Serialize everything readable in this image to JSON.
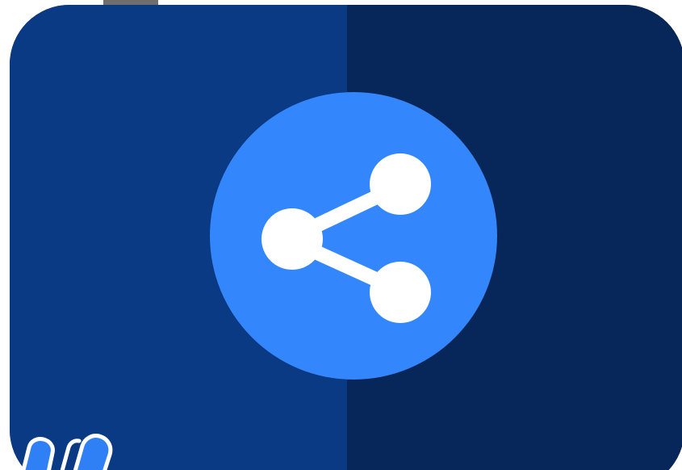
{
  "colors": {
    "card_left": "#0a3a84",
    "card_right": "#07275a",
    "circle": "#3386fb",
    "icon": "#ffffff",
    "badge": "#2f80f4",
    "badge_outline": "#ffffff",
    "top_tab": "#6f6f6f"
  },
  "icons": {
    "main": "share-icon",
    "badge": "partial-blue-logo"
  }
}
